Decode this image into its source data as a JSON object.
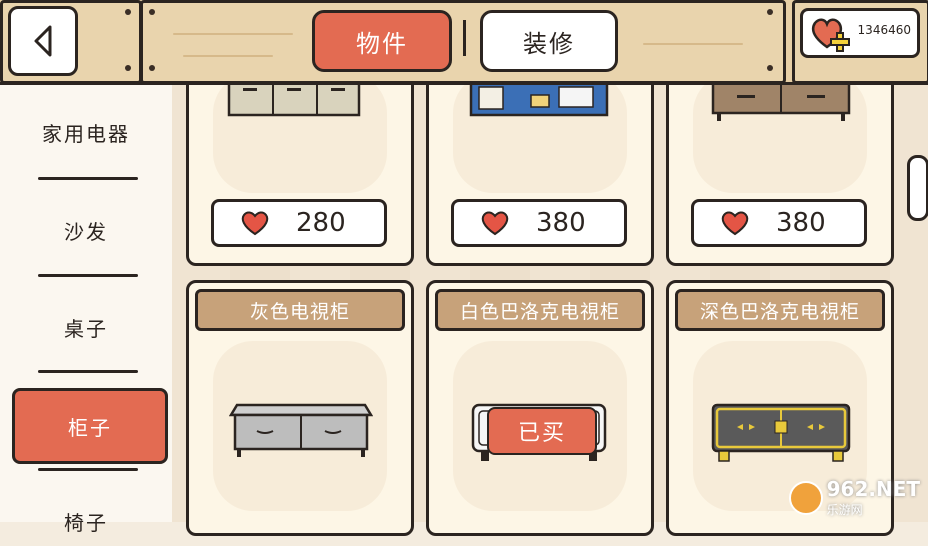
{
  "header": {
    "tabs": [
      {
        "label": "物件",
        "active": true
      },
      {
        "label": "装修",
        "active": false
      }
    ],
    "hearts": "1346460"
  },
  "sidebar": {
    "categories": [
      {
        "label": "家用电器",
        "active": false
      },
      {
        "label": "沙发",
        "active": false
      },
      {
        "label": "桌子",
        "active": false
      },
      {
        "label": "柜子",
        "active": true
      },
      {
        "label": "椅子",
        "active": false
      }
    ]
  },
  "items": [
    {
      "name": "",
      "price": "280",
      "status": "buy"
    },
    {
      "name": "",
      "price": "380",
      "status": "buy"
    },
    {
      "name": "",
      "price": "380",
      "status": "buy"
    },
    {
      "name": "灰色电視柜",
      "price": "",
      "status": "buy"
    },
    {
      "name": "白色巴洛克电視柜",
      "price": "",
      "status": "bought",
      "bought_label": "已买"
    },
    {
      "name": "深色巴洛克电視柜",
      "price": "",
      "status": "buy"
    }
  ],
  "watermark": {
    "text": "962.NET",
    "sub": "乐游网"
  },
  "colors": {
    "accent": "#e36b52",
    "wood": "#e9d4ad",
    "outline": "#2b2420",
    "plate": "#c7a27a"
  }
}
